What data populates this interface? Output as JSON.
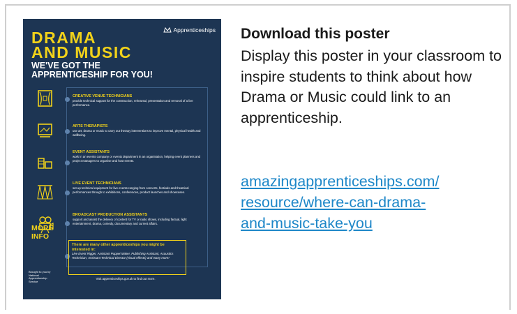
{
  "poster": {
    "logo_text": "Apprenticeships",
    "title_line1": "DRAMA",
    "title_line2": "AND MUSIC",
    "subtitle_line1": "WE'VE GOT THE",
    "subtitle_line2": "APPRENTICESHIP FOR YOU!",
    "more_info_line1": "MORE",
    "more_info_line2": "INFO",
    "icons": [
      "stage-icon",
      "screen-icon",
      "event-icon",
      "stage-lights-icon",
      "camera-icon"
    ],
    "items": [
      {
        "heading": "CREATIVE VENUE TECHNICIANS",
        "text": "provide technical support for the construction, rehearsal, presentation and removal of a live performance."
      },
      {
        "heading": "ARTS THERAPISTS",
        "text": "use art, drama or music to carry out therapy interventions to improve mental, physical health and wellbeing."
      },
      {
        "heading": "EVENT ASSISTANTS",
        "text": "work in an events company or events department in an organisation, helping event planners and project managers to organise and host events."
      },
      {
        "heading": "LIVE EVENT TECHNICIANS",
        "text": "set up technical equipment for live events ranging from concerts, festivals and theatrical performances through to exhibitions, conferences, product launches and showcases."
      },
      {
        "heading": "BROADCAST PRODUCTION ASSISTANTS",
        "text": "support and assist the delivery of content for TV or radio shows, including factual, light entertainment, drama, comedy, documentary and current affairs."
      }
    ],
    "box_heading": "There are many other apprenticeships you might be interested in:",
    "box_text": "Live Event Rigger, Assistant Puppet Maker, Publishing Assistant, Acoustics Technician, Assistant Technical Director (visual effects) and many more!",
    "footer_left": "Brought to you by National Apprenticeship Service",
    "footer_center": "Visit apprenticeships.gov.uk to find out more."
  },
  "download": {
    "title": "Download this poster",
    "body": "Display this poster in your classroom to inspire students to think about how Drama or Music could link to an apprenticeship.",
    "link_line1": "amazingapprenticeships.com/",
    "link_line2": "resource/where-can-drama-",
    "link_line3": "and-music-take-you"
  },
  "colors": {
    "poster_bg": "#1d3553",
    "accent_yellow": "#f2d21a",
    "link_blue": "#1e87c8"
  }
}
